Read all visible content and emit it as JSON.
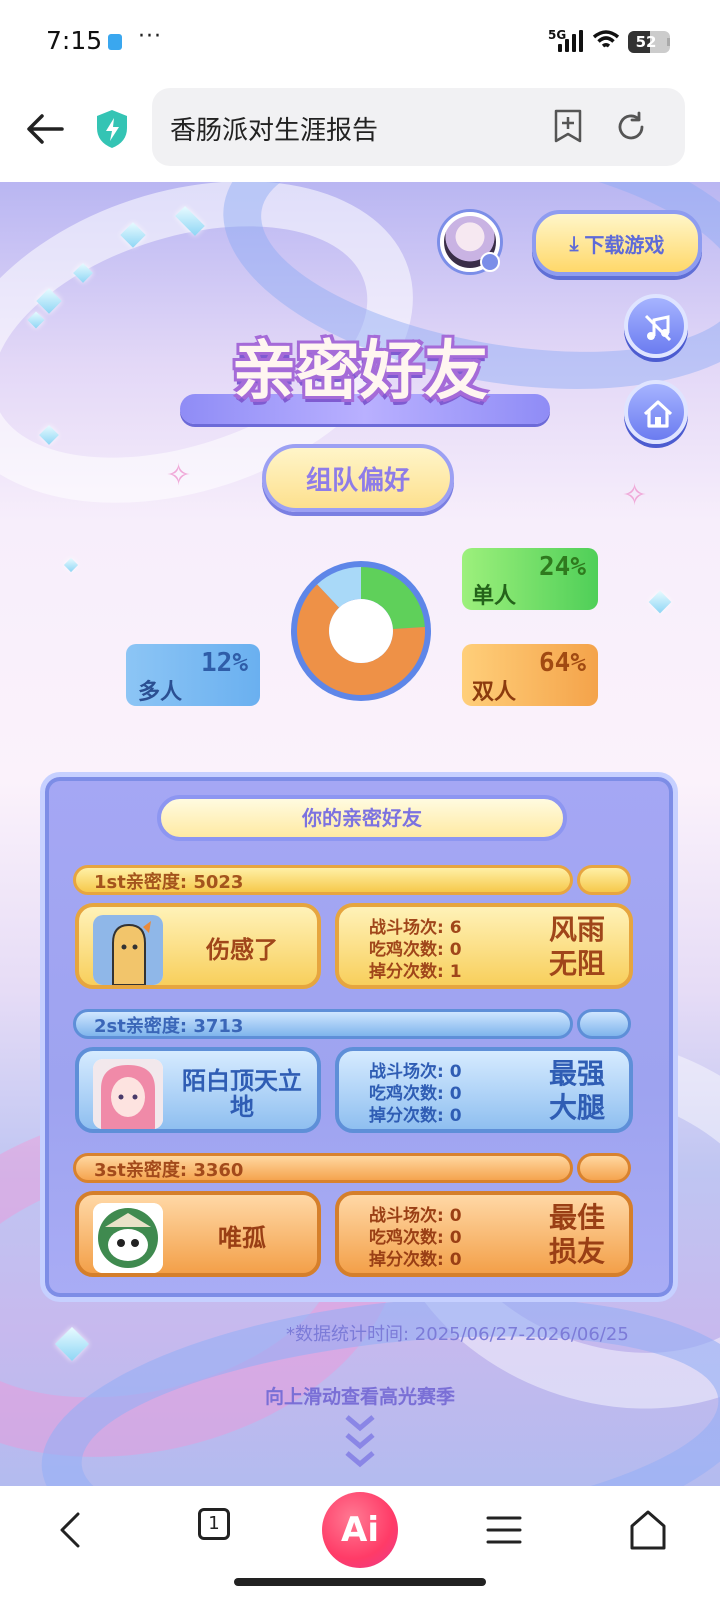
{
  "status_bar": {
    "time": "7:15",
    "dots": "···",
    "network": "5G",
    "battery": "52",
    "battery_level": 0.52
  },
  "browser": {
    "url_title": "香肠派对生涯报告"
  },
  "page": {
    "download_label": "下载游戏",
    "section_title": "亲密好友",
    "preference_label": "组队偏好",
    "team_preference": [
      {
        "label": "单人",
        "percent_text": "24%",
        "value": 24,
        "color": "#5fd05a"
      },
      {
        "label": "多人",
        "percent_text": "12%",
        "value": 12,
        "color": "#a9d9f8"
      },
      {
        "label": "双人",
        "percent_text": "64%",
        "value": 64,
        "color": "#ee9147"
      }
    ],
    "friends_heading": "你的亲密好友",
    "friends": [
      {
        "rank_label": "1st亲密度:",
        "score": "5023",
        "name": "伤感了",
        "battles": "战斗场次: 6",
        "wins": "吃鸡次数: 0",
        "lost": "掉分次数: 1",
        "title": "风雨无阻"
      },
      {
        "rank_label": "2st亲密度:",
        "score": "3713",
        "name": "陌白顶天立地",
        "battles": "战斗场次: 0",
        "wins": "吃鸡次数: 0",
        "lost": "掉分次数: 0",
        "title": "最强大腿"
      },
      {
        "rank_label": "3st亲密度:",
        "score": "3360",
        "name": "唯孤",
        "battles": "战斗场次: 0",
        "wins": "吃鸡次数: 0",
        "lost": "掉分次数: 0",
        "title": "最佳损友"
      }
    ],
    "stat_time": "*数据统计时间: 2025/06/27-2026/06/25",
    "scroll_hint": "向上滑动查看高光赛季"
  },
  "bottom_nav": {
    "tab_count": "1",
    "ai_label": "Ai"
  }
}
